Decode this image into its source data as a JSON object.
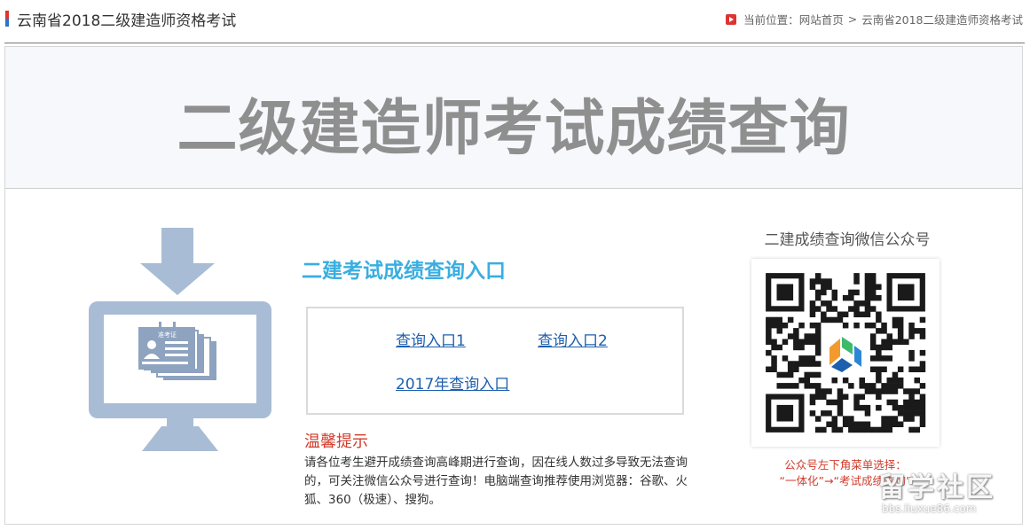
{
  "header": {
    "site_title": "云南省2018二级建造师资格考试",
    "breadcrumb_prefix": "当前位置：",
    "breadcrumb_home": "网站首页",
    "breadcrumb_sep": ">",
    "breadcrumb_current": "云南省2018二级建造师资格考试"
  },
  "banner": {
    "title": "二级建造师考试成绩查询"
  },
  "entry": {
    "title": "二建考试成绩查询入口",
    "links": [
      "查询入口1",
      "查询入口2",
      "2017年查询入口"
    ]
  },
  "tips": {
    "title": "温馨提示",
    "text": "请各位考生避开成绩查询高峰期进行查询，因在线人数过多导致无法查询的，可关注微信公众号进行查询！电脑端查询推荐使用浏览器：谷歌、火狐、360（极速）、搜狗。"
  },
  "wechat": {
    "title": "二建成绩查询微信公众号",
    "hint_line1": "公众号左下角菜单选择：",
    "hint_line2": "“一体化”→“考试成绩查询”"
  },
  "illustration": {
    "card_label": "准考证"
  },
  "watermark": {
    "title": "留学社区",
    "url": "bbs.liuxue86.com"
  },
  "colors": {
    "accent_blue": "#3aaee0",
    "link_blue": "#1e5fae",
    "tip_red": "#d23c2c",
    "banner_text": "#8f8f8f",
    "illustration_blue": "#a9bcd5",
    "logo_red": "#e1332c",
    "logo_blue": "#2b74c8"
  }
}
